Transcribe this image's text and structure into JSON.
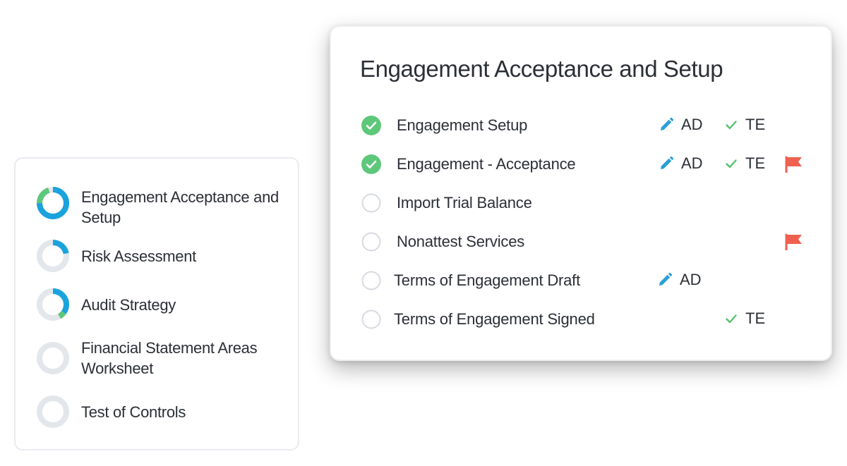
{
  "sidebar": {
    "items": [
      {
        "label": "Engagement Acceptance and Setup",
        "progress_blue": 0.75,
        "progress_green": 0.2
      },
      {
        "label": "Risk Assessment",
        "progress_blue": 0.22,
        "progress_green": 0.0
      },
      {
        "label": "Audit Strategy",
        "progress_blue": 0.35,
        "progress_green": 0.07
      },
      {
        "label": "Financial Statement Areas Worksheet",
        "progress_blue": 0.0,
        "progress_green": 0.0
      },
      {
        "label": "Test of Controls",
        "progress_blue": 0.0,
        "progress_green": 0.0
      }
    ]
  },
  "panel": {
    "title": "Engagement Acceptance and Setup",
    "tasks": [
      {
        "label": "Engagement Setup",
        "status": "complete",
        "preparer": "AD",
        "reviewer": "TE",
        "flagged": false
      },
      {
        "label": "Engagement - Acceptance",
        "status": "complete",
        "preparer": "AD",
        "reviewer": "TE",
        "flagged": true
      },
      {
        "label": "Import Trial Balance",
        "status": "incomplete",
        "preparer": "",
        "reviewer": "",
        "flagged": false
      },
      {
        "label": "Nonattest Services",
        "status": "incomplete",
        "preparer": "",
        "reviewer": "",
        "flagged": true
      },
      {
        "label": "Terms of Engagement Draft",
        "status": "incomplete",
        "preparer": "AD",
        "reviewer": "",
        "flagged": false
      },
      {
        "label": "Terms of Engagement Signed",
        "status": "incomplete",
        "preparer": "",
        "reviewer": "TE",
        "flagged": false
      }
    ]
  },
  "icons": {
    "check_circle": "check-circle-icon",
    "empty_circle": "empty-circle-icon",
    "pencil": "pencil-icon",
    "check": "check-icon",
    "flag": "flag-icon"
  },
  "colors": {
    "blue": "#1aa3dd",
    "green": "#5dc77a",
    "track": "#e3e7ec",
    "flag_red": "#f0604f",
    "check_green": "#56c16f",
    "pencil_blue": "#2a9fd8"
  }
}
